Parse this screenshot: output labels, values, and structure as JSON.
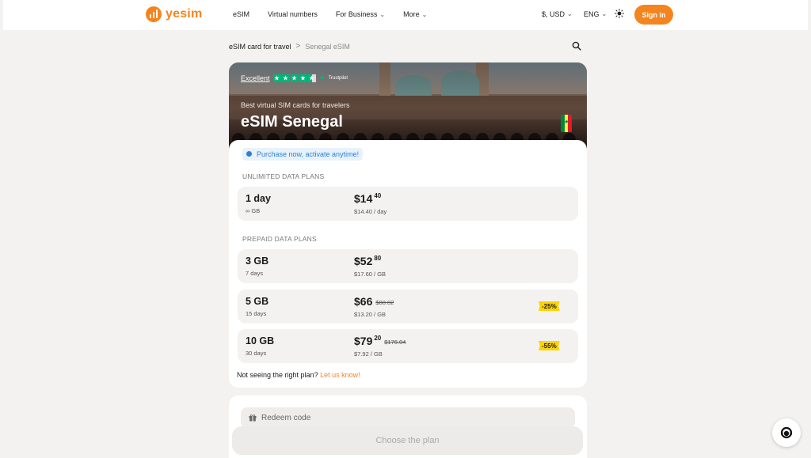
{
  "header": {
    "logo_text": "yesim",
    "nav": [
      {
        "label": "eSIM",
        "dropdown": false
      },
      {
        "label": "Virtual numbers",
        "dropdown": false
      },
      {
        "label": "For Business",
        "dropdown": true
      },
      {
        "label": "More",
        "dropdown": true
      }
    ],
    "currency": "$, USD",
    "language": "ENG",
    "theme_icon": "sun-icon",
    "signin_label": "Sign in"
  },
  "breadcrumb": {
    "items": [
      "eSIM card for travel",
      "Senegal eSIM"
    ],
    "separator": ">"
  },
  "hero": {
    "rating_word": "Excellent",
    "trustpilot_label": "Trustpilot",
    "subtitle": "Best virtual SIM cards for travelers",
    "title": "eSIM Senegal",
    "flag_icon": "senegal-flag-icon"
  },
  "promo": "Purchase now, activate anytime!",
  "unlimited": {
    "heading": "UNLIMITED DATA PLANS",
    "plans": [
      {
        "name": "1 day",
        "sub": "∞ GB",
        "price_main": "$14",
        "price_cents": "40",
        "unit": "$14.40 / day"
      }
    ]
  },
  "prepaid": {
    "heading": "PREPAID DATA PLANS",
    "plans": [
      {
        "name": "3 GB",
        "sub": "7 days",
        "price_main": "$52",
        "price_cents": "80",
        "old_price": "",
        "unit": "$17.60 / GB",
        "badge": ""
      },
      {
        "name": "5 GB",
        "sub": "15 days",
        "price_main": "$66",
        "price_cents": "",
        "old_price": "$88.02",
        "unit": "$13.20 / GB",
        "badge": "-25%"
      },
      {
        "name": "10 GB",
        "sub": "30 days",
        "price_main": "$79",
        "price_cents": "20",
        "old_price": "$176.04",
        "unit": "$7.92 / GB",
        "badge": "-55%"
      }
    ]
  },
  "not_seeing": {
    "text": "Not seeing the right plan?",
    "link": "Let us know!"
  },
  "redeem": {
    "placeholder": "Redeem code"
  },
  "choose_label": "Choose the plan",
  "colors": {
    "accent": "#f5841f",
    "promo_blue": "#2e7fd8",
    "badge_yellow": "#ffd300",
    "trustpilot_green": "#00b67a"
  }
}
